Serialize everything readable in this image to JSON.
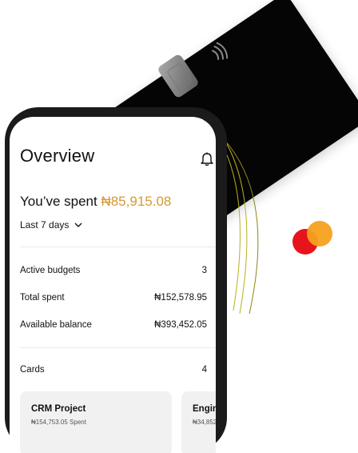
{
  "overview": {
    "title": "Overview",
    "spent_prefix": "You’ve spent ",
    "spent_amount": "₦85,915.08",
    "range_label": "Last 7 days"
  },
  "stats": [
    {
      "label": "Active budgets",
      "value": "3"
    },
    {
      "label": "Total spent",
      "value": "₦152,578.95"
    },
    {
      "label": "Available balance",
      "value": "₦393,452.05"
    }
  ],
  "cards_section": {
    "label": "Cards",
    "count": "4"
  },
  "project_cards": [
    {
      "title": "CRM Project",
      "subtitle": "₦154,753.05 Spent"
    },
    {
      "title": "Engin",
      "subtitle": "₦34,852"
    }
  ],
  "colors": {
    "accent": "#d59a31",
    "card_black": "#050505"
  },
  "icons": [
    "bell-icon",
    "chevron-down-icon",
    "contactless-icon",
    "mastercard-logo"
  ]
}
